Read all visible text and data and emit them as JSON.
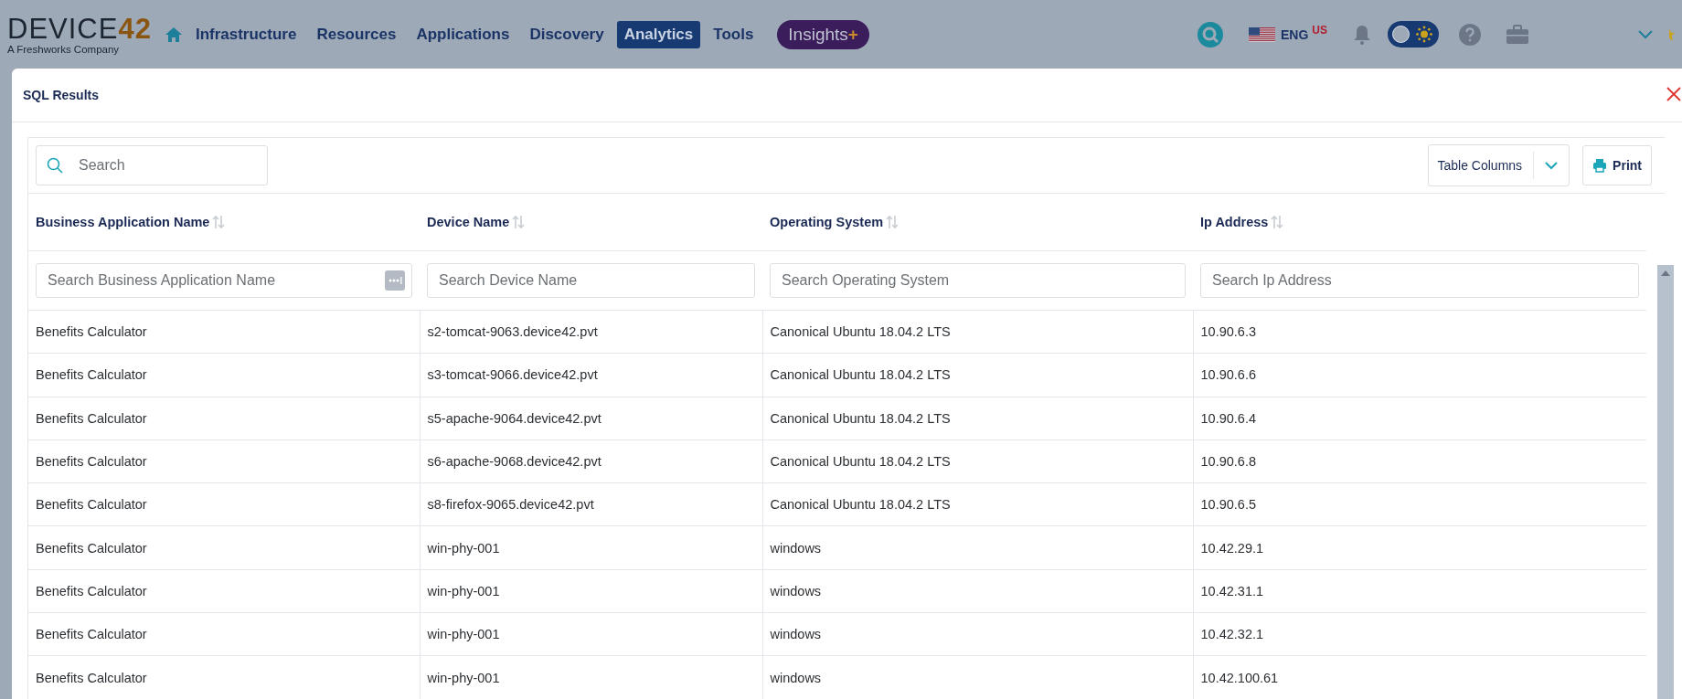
{
  "logo": {
    "name": "DEVICE",
    "number": "42",
    "tagline": "A Freshworks Company"
  },
  "nav": {
    "items": [
      {
        "label": "Infrastructure",
        "selected": false
      },
      {
        "label": "Resources",
        "selected": false
      },
      {
        "label": "Applications",
        "selected": false
      },
      {
        "label": "Discovery",
        "selected": false
      },
      {
        "label": "Analytics",
        "selected": true
      },
      {
        "label": "Tools",
        "selected": false
      }
    ],
    "insights": {
      "label": "Insights",
      "suffix": "+"
    }
  },
  "header_right": {
    "language": "ENG",
    "region": "US"
  },
  "dialog": {
    "title": "SQL Results",
    "search": {
      "placeholder": "Search"
    },
    "table_columns_button": "Table Columns",
    "print_button": "Print",
    "table": {
      "columns": [
        {
          "label": "Business Application Name",
          "filter_placeholder": "Search Business Application Name"
        },
        {
          "label": "Device Name",
          "filter_placeholder": "Search Device Name"
        },
        {
          "label": "Operating System",
          "filter_placeholder": "Search Operating System"
        },
        {
          "label": "Ip Address",
          "filter_placeholder": "Search Ip Address"
        }
      ],
      "rows": [
        [
          "Benefits Calculator",
          "s2-tomcat-9063.device42.pvt",
          "Canonical Ubuntu 18.04.2 LTS",
          "10.90.6.3"
        ],
        [
          "Benefits Calculator",
          "s3-tomcat-9066.device42.pvt",
          "Canonical Ubuntu 18.04.2 LTS",
          "10.90.6.6"
        ],
        [
          "Benefits Calculator",
          "s5-apache-9064.device42.pvt",
          "Canonical Ubuntu 18.04.2 LTS",
          "10.90.6.4"
        ],
        [
          "Benefits Calculator",
          "s6-apache-9068.device42.pvt",
          "Canonical Ubuntu 18.04.2 LTS",
          "10.90.6.8"
        ],
        [
          "Benefits Calculator",
          "s8-firefox-9065.device42.pvt",
          "Canonical Ubuntu 18.04.2 LTS",
          "10.90.6.5"
        ],
        [
          "Benefits Calculator",
          "win-phy-001",
          "windows",
          "10.42.29.1"
        ],
        [
          "Benefits Calculator",
          "win-phy-001",
          "windows",
          "10.42.31.1"
        ],
        [
          "Benefits Calculator",
          "win-phy-001",
          "windows",
          "10.42.32.1"
        ],
        [
          "Benefits Calculator",
          "win-phy-001",
          "windows",
          "10.42.100.61"
        ]
      ]
    }
  }
}
